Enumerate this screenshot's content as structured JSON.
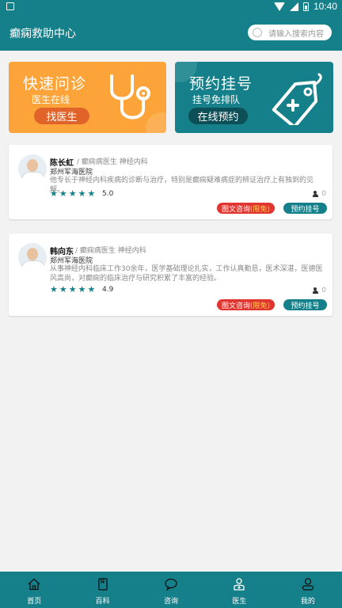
{
  "status_bar": {
    "time": "10:40"
  },
  "header": {
    "title": "癫痫救助中心",
    "search_placeholder": "请输入搜索内容"
  },
  "banners": [
    {
      "title": "快速问诊",
      "subtitle": "医生在线",
      "button": "找医生",
      "icon": "stethoscope-icon"
    },
    {
      "title": "预约挂号",
      "subtitle": "挂号免排队",
      "button": "在线预约",
      "icon": "price-tag-icon"
    }
  ],
  "doctors": [
    {
      "name": "陈长虹",
      "category": "癫痫病医生",
      "department": "神经内科",
      "hospital": "郑州军海医院",
      "description": "他专长于神经内科疾病的诊断与治疗，特别是癫痫疑难病症的辨证治疗上有独到的见解。",
      "rating": "5.0",
      "count": "0",
      "consult_label": "图文咨询",
      "consult_tag": "(限免)",
      "appointment_label": "预约挂号"
    },
    {
      "name": "韩向东",
      "category": "癫痫病医生",
      "department": "神经内科",
      "hospital": "郑州军海医院",
      "description": "从事神经内科临床工作30余年，医学基础理论扎实，工作认真勤恳，医术深湛，医德医风高尚，对癫痫的临床治疗与研究积累了丰富的经验。",
      "rating": "4.9",
      "count": "0",
      "consult_label": "图文咨询",
      "consult_tag": "(限免)",
      "appointment_label": "预约挂号"
    }
  ],
  "tabbar": [
    {
      "label": "首页",
      "icon": "home-icon"
    },
    {
      "label": "百科",
      "icon": "book-icon"
    },
    {
      "label": "咨询",
      "icon": "chat-bubble-icon"
    },
    {
      "label": "医生",
      "icon": "doctor-icon",
      "active": true
    },
    {
      "label": "我的",
      "icon": "user-icon"
    }
  ],
  "colors": {
    "primary": "#15808a",
    "orange": "#fca43a",
    "red": "#e1352f"
  }
}
